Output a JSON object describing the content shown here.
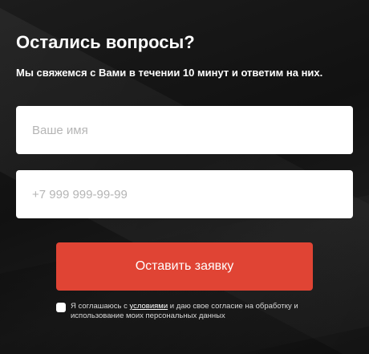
{
  "form": {
    "title": "Остались вопросы?",
    "subtitle": "Мы свяжемся с Вами в течении 10 минут и ответим на них.",
    "name_field": {
      "placeholder": "Ваше имя",
      "value": ""
    },
    "phone_field": {
      "placeholder": "+7 999 999-99-99",
      "value": ""
    },
    "submit_label": "Оставить заявку",
    "consent": {
      "checked": false,
      "prefix": "Я соглашаюсь с ",
      "link_text": "условиями",
      "suffix": " и даю свое согласие на обработку и использование моих персональных данных"
    }
  },
  "colors": {
    "accent": "#e04434",
    "background": "#151515",
    "field_background": "#ffffff"
  }
}
